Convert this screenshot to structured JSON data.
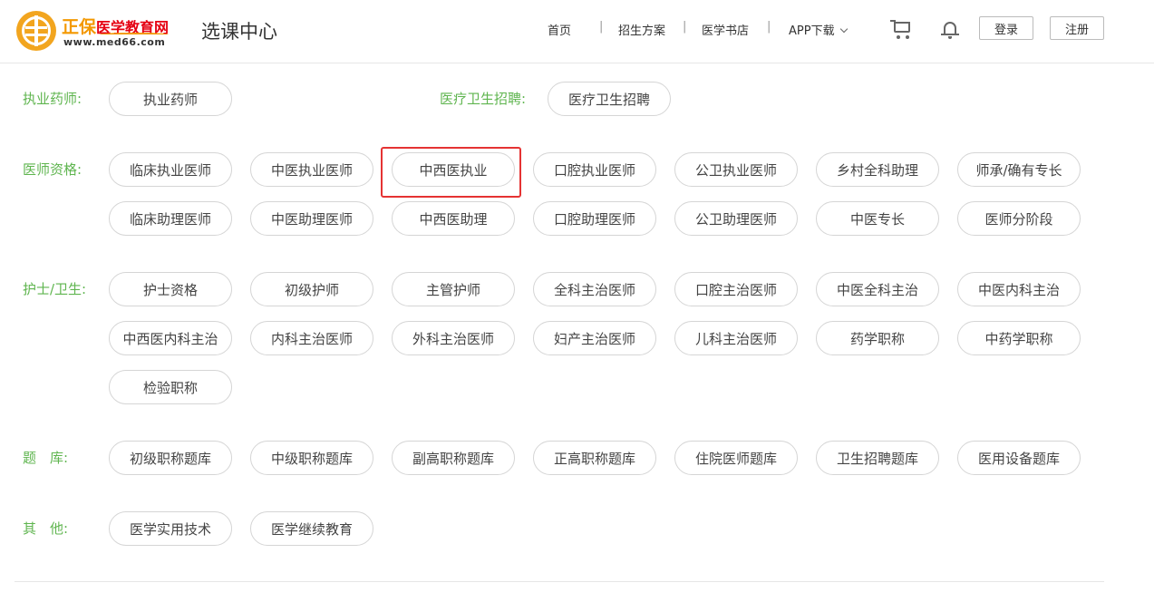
{
  "header": {
    "logo_name_a": "正保",
    "logo_name_b": "医学教育网",
    "logo_url": "www.med66.com",
    "page_title": "选课中心",
    "nav": {
      "home": "首页",
      "enroll": "招生方案",
      "bookstore": "医学书店",
      "app": "APP下载",
      "separator": "|"
    },
    "login": "登录",
    "register": "注册"
  },
  "categories": {
    "pharmacist": {
      "label": "执业药师:",
      "items": [
        "执业药师"
      ]
    },
    "recruit": {
      "label": "医疗卫生招聘:",
      "items": [
        "医疗卫生招聘"
      ]
    },
    "doctor": {
      "label": "医师资格:",
      "row1": [
        "临床执业医师",
        "中医执业医师",
        "中西医执业",
        "口腔执业医师",
        "公卫执业医师",
        "乡村全科助理",
        "师承/确有专长"
      ],
      "row2": [
        "临床助理医师",
        "中医助理医师",
        "中西医助理",
        "口腔助理医师",
        "公卫助理医师",
        "中医专长",
        "医师分阶段"
      ]
    },
    "nurse": {
      "label": "护士/卫生:",
      "row1": [
        "护士资格",
        "初级护师",
        "主管护师",
        "全科主治医师",
        "口腔主治医师",
        "中医全科主治",
        "中医内科主治"
      ],
      "row2": [
        "中西医内科主治",
        "内科主治医师",
        "外科主治医师",
        "妇产主治医师",
        "儿科主治医师",
        "药学职称",
        "中药学职称"
      ],
      "row3": [
        "检验职称"
      ]
    },
    "question_bank": {
      "label": "题　库:",
      "row1": [
        "初级职称题库",
        "中级职称题库",
        "副高职称题库",
        "正高职称题库",
        "住院医师题库",
        "卫生招聘题库",
        "医用设备题库"
      ]
    },
    "other": {
      "label": "其　他:",
      "row1": [
        "医学实用技术",
        "医学继续教育"
      ]
    }
  },
  "colors": {
    "category_label": "#5fb54f",
    "highlight": "#e53333",
    "logo_orange": "#f2a51f",
    "logo_red": "#e50012"
  }
}
